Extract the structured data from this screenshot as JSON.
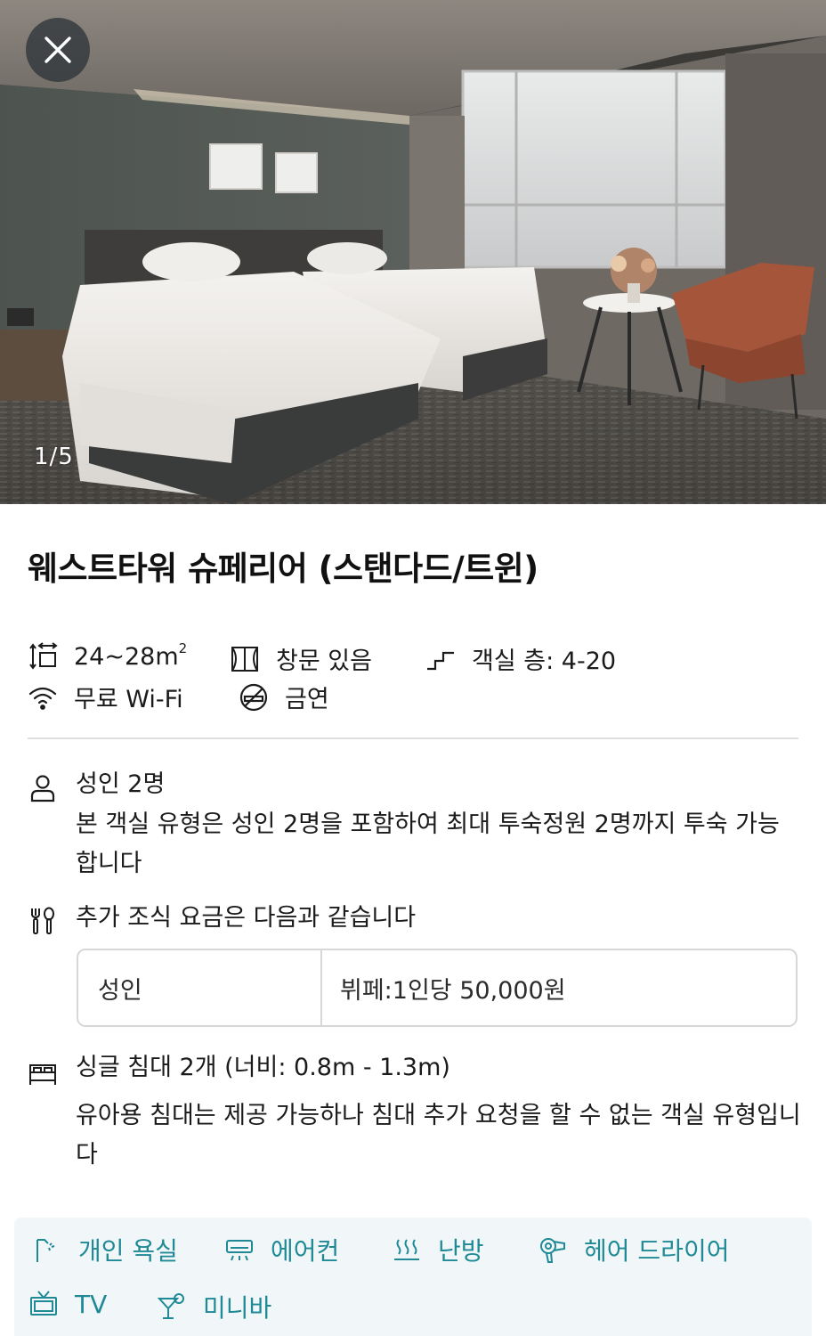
{
  "gallery": {
    "counter": "1/5"
  },
  "room": {
    "title": "웨스트타워 슈페리어 (스탠다드/트윈)"
  },
  "features": {
    "size": {
      "value": "24~28m",
      "unit_sup": "2",
      "icon": "room-size-icon"
    },
    "window": {
      "label": "창문 있음",
      "icon": "window-icon"
    },
    "floor": {
      "label": "객실 층: 4-20",
      "icon": "stairs-icon"
    },
    "wifi": {
      "label": "무료 Wi-Fi",
      "icon": "wifi-icon"
    },
    "smoking": {
      "label": "금연",
      "icon": "no-smoking-icon"
    }
  },
  "occupancy": {
    "title": "성인 2명",
    "description": "본 객실 유형은 성인 2명을 포함하여 최대 투숙정원 2명까지 투숙 가능합니다"
  },
  "breakfast": {
    "title": "추가 조식 요금은 다음과 같습니다",
    "rows": [
      {
        "guest": "성인",
        "price": "뷔페:1인당 50,000원"
      }
    ]
  },
  "bed": {
    "title": "싱글 침대 2개 (너비: 0.8m - 1.3m)",
    "description": "유아용 침대는 제공 가능하나 침대 추가 요청을 할 수 없는 객실 유형입니다"
  },
  "amenities": [
    {
      "label": "개인 욕실",
      "icon": "shower-icon"
    },
    {
      "label": "에어컨",
      "icon": "air-conditioner-icon"
    },
    {
      "label": "난방",
      "icon": "heating-icon"
    },
    {
      "label": "헤어 드라이어",
      "icon": "hair-dryer-icon"
    },
    {
      "label": "TV",
      "icon": "tv-icon"
    },
    {
      "label": "미니바",
      "icon": "cocktail-icon"
    }
  ],
  "colors": {
    "accent": "#1f8a96",
    "amenity_bg": "#f1f7f8",
    "divider": "#dedede"
  }
}
